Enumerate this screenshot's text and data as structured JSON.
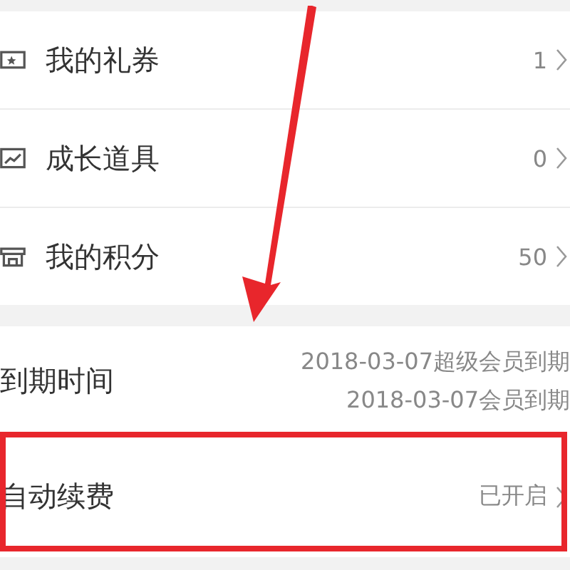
{
  "menu_items": [
    {
      "kind": "ticket",
      "label": "我的礼券",
      "value": "1"
    },
    {
      "kind": "chart",
      "label": "成长道具",
      "value": "0"
    },
    {
      "kind": "shop",
      "label": "我的积分",
      "value": "50"
    }
  ],
  "expiry": {
    "label": "到期时间",
    "lines": [
      "2018-03-07超级会员到期",
      "2018-03-07会员到期"
    ]
  },
  "auto_renew": {
    "label": "自动续费",
    "value": "已开启"
  }
}
